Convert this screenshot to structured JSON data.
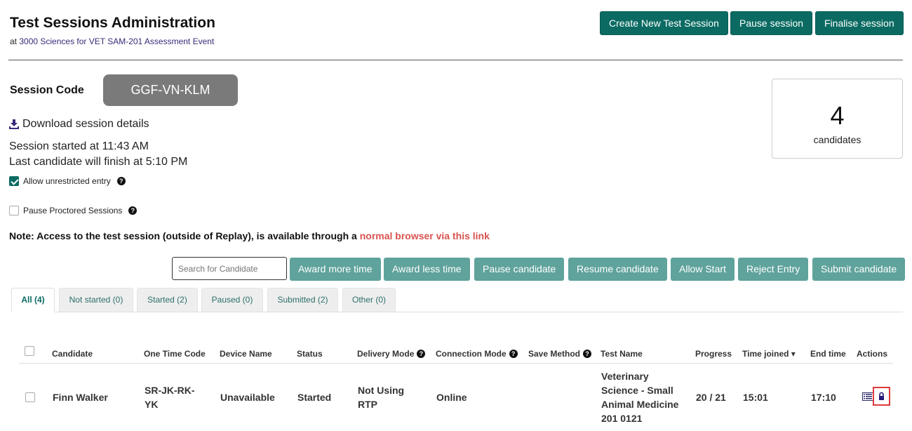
{
  "header": {
    "title": "Test Sessions Administration",
    "subtitle_prefix": "at",
    "subtitle_link": "3000 Sciences for VET SAM-201 Assessment Event",
    "buttons": {
      "create": "Create New Test Session",
      "pause": "Pause session",
      "finalise": "Finalise session"
    }
  },
  "session": {
    "code_label": "Session Code",
    "code": "GGF-VN-KLM",
    "download_label": "Download session details",
    "started_text": "Session started at 11:43 AM",
    "finish_text": "Last candidate will finish at 5:10 PM",
    "allow_unrestricted_label": "Allow unrestricted entry",
    "allow_unrestricted_checked": true,
    "pause_proctored_label": "Pause Proctored Sessions",
    "pause_proctored_checked": false
  },
  "candidates_card": {
    "count": "4",
    "label": "candidates"
  },
  "note": {
    "text": "Note: Access to the test session (outside of Replay), is available through a",
    "link": "normal browser via this link"
  },
  "toolbar": {
    "search_placeholder": "Search for Candidate",
    "award_more": "Award more time",
    "award_less": "Award less time",
    "pause_candidate": "Pause candidate",
    "resume_candidate": "Resume candidate",
    "allow_start": "Allow Start",
    "reject_entry": "Reject Entry",
    "submit_candidate": "Submit candidate"
  },
  "tabs": [
    {
      "label": "All (4)"
    },
    {
      "label": "Not started (0)"
    },
    {
      "label": "Started (2)"
    },
    {
      "label": "Paused (0)"
    },
    {
      "label": "Submitted (2)"
    },
    {
      "label": "Other (0)"
    }
  ],
  "table": {
    "headers": {
      "candidate": "Candidate",
      "otc": "One Time Code",
      "device": "Device Name",
      "status": "Status",
      "delivery": "Delivery Mode",
      "connection": "Connection Mode",
      "save": "Save Method",
      "test": "Test Name",
      "progress": "Progress",
      "time_joined": "Time joined ▾",
      "end_time": "End time",
      "actions": "Actions"
    },
    "rows": [
      {
        "candidate": "Finn Walker",
        "otc_line1": "SR-JK-RK-",
        "otc_line2": "YK",
        "device": "Unavailable",
        "status": "Started",
        "delivery_line1": "Not Using",
        "delivery_line2": "RTP",
        "connection": "Online",
        "save": "",
        "test_line1": "Veterinary",
        "test_line2": "Science - Small",
        "test_line3": "Animal Medicine",
        "test_line4": "201 0121",
        "progress": "20 / 21",
        "time_joined": "15:01",
        "end_time": "17:10"
      }
    ]
  },
  "colors": {
    "primary": "#0b6b63",
    "secondary_button": "#5fa39c",
    "link_red": "#d9534f",
    "highlight_box": "#e03a3a"
  }
}
